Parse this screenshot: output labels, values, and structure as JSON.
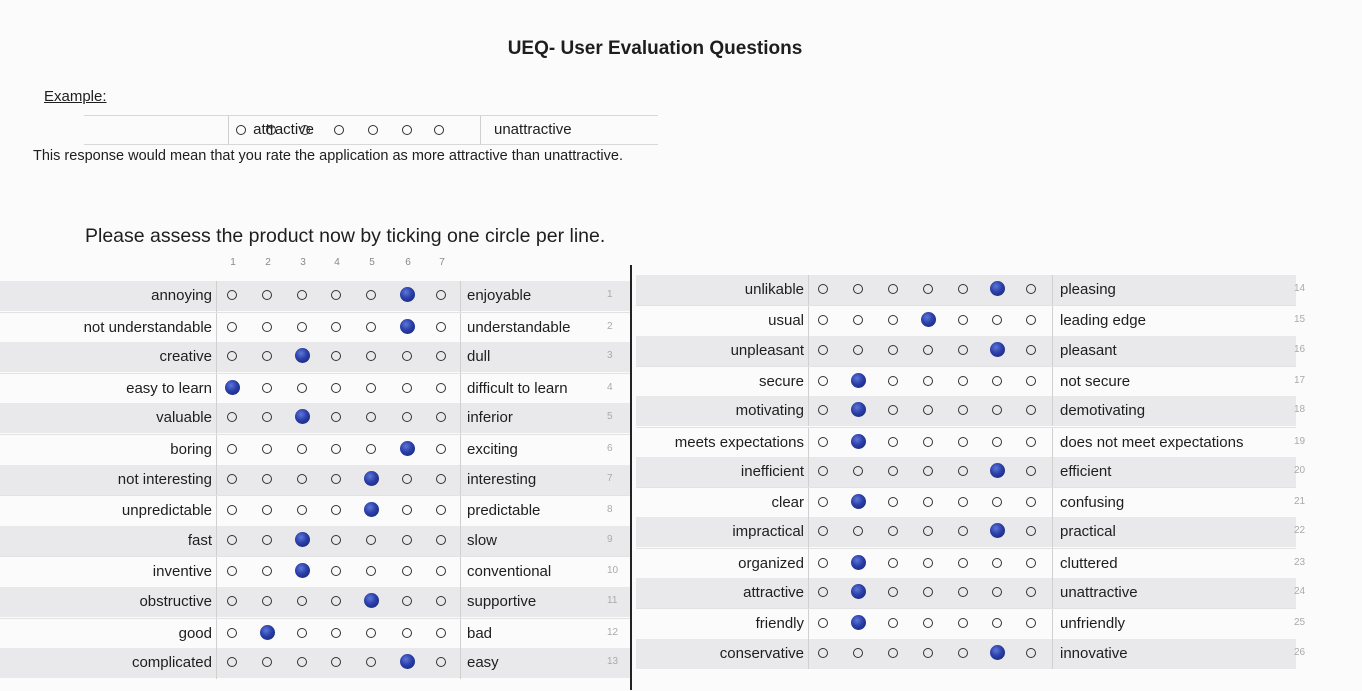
{
  "title": "UEQ- User Evaluation Questions",
  "example": {
    "label": "Example:",
    "left": "attractive",
    "right": "unattractive",
    "selected": 2,
    "note": "This response would mean that you rate the application as more attractive than unattractive."
  },
  "instruction": "Please assess the product now by ticking one circle per line.",
  "scale": [
    "1",
    "2",
    "3",
    "4",
    "5",
    "6",
    "7"
  ],
  "left_items": [
    {
      "n": "1",
      "left": "annoying",
      "right": "enjoyable",
      "checked": 6
    },
    {
      "n": "2",
      "left": "not understandable",
      "right": "understandable",
      "checked": 6
    },
    {
      "n": "3",
      "left": "creative",
      "right": "dull",
      "checked": 3
    },
    {
      "n": "4",
      "left": "easy to learn",
      "right": "difficult to learn",
      "checked": 1
    },
    {
      "n": "5",
      "left": "valuable",
      "right": "inferior",
      "checked": 3
    },
    {
      "n": "6",
      "left": "boring",
      "right": "exciting",
      "checked": 6
    },
    {
      "n": "7",
      "left": "not interesting",
      "right": "interesting",
      "checked": 5
    },
    {
      "n": "8",
      "left": "unpredictable",
      "right": "predictable",
      "checked": 5
    },
    {
      "n": "9",
      "left": "fast",
      "right": "slow",
      "checked": 3
    },
    {
      "n": "10",
      "left": "inventive",
      "right": "conventional",
      "checked": 3
    },
    {
      "n": "11",
      "left": "obstructive",
      "right": "supportive",
      "checked": 5
    },
    {
      "n": "12",
      "left": "good",
      "right": "bad",
      "checked": 2
    },
    {
      "n": "13",
      "left": "complicated",
      "right": "easy",
      "checked": 6
    }
  ],
  "right_items": [
    {
      "n": "14",
      "left": "unlikable",
      "right": "pleasing",
      "checked": 6
    },
    {
      "n": "15",
      "left": "usual",
      "right": "leading edge",
      "checked": 4
    },
    {
      "n": "16",
      "left": "unpleasant",
      "right": "pleasant",
      "checked": 6
    },
    {
      "n": "17",
      "left": "secure",
      "right": "not secure",
      "checked": 2
    },
    {
      "n": "18",
      "left": "motivating",
      "right": "demotivating",
      "checked": 2
    },
    {
      "n": "19",
      "left": "meets expectations",
      "right": "does not meet expectations",
      "checked": 2
    },
    {
      "n": "20",
      "left": "inefficient",
      "right": "efficient",
      "checked": 6
    },
    {
      "n": "21",
      "left": "clear",
      "right": "confusing",
      "checked": 2
    },
    {
      "n": "22",
      "left": "impractical",
      "right": "practical",
      "checked": 6
    },
    {
      "n": "23",
      "left": "organized",
      "right": "cluttered",
      "checked": 2
    },
    {
      "n": "24",
      "left": "attractive",
      "right": "unattractive",
      "checked": 2
    },
    {
      "n": "25",
      "left": "friendly",
      "right": "unfriendly",
      "checked": 2
    },
    {
      "n": "26",
      "left": "conservative",
      "right": "innovative",
      "checked": 6
    }
  ]
}
